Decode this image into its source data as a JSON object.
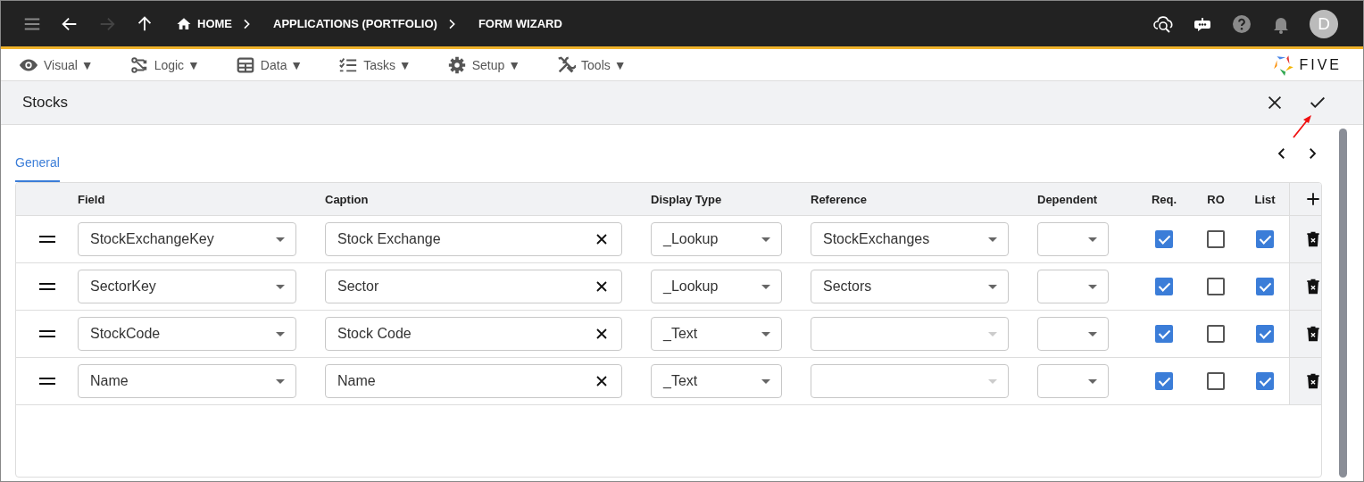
{
  "top_bar": {
    "nav": [
      {
        "kind": "menu",
        "disabled": false
      },
      {
        "kind": "back",
        "disabled": false
      },
      {
        "kind": "forward",
        "disabled": true
      },
      {
        "kind": "up",
        "disabled": false
      }
    ],
    "breadcrumbs": [
      {
        "label": "HOME",
        "kind": "home"
      },
      {
        "label": "APPLICATIONS (PORTFOLIO)"
      },
      {
        "label": "FORM WIZARD"
      }
    ],
    "avatar": "D"
  },
  "menu_bar": [
    {
      "label": "Visual ▼",
      "kind": "eye"
    },
    {
      "label": "Logic ▼",
      "kind": "logic"
    },
    {
      "label": "Data ▼",
      "kind": "table"
    },
    {
      "label": "Tasks ▼",
      "kind": "tasks"
    },
    {
      "label": "Setup ▼",
      "kind": "gear"
    },
    {
      "label": "Tools ▼",
      "kind": "tools"
    }
  ],
  "logo": "FIVE",
  "panel": {
    "title": "Stocks"
  },
  "tabs": [
    {
      "label": "General",
      "selected": true
    }
  ],
  "table": {
    "columns": [
      "Field",
      "Caption",
      "Display Type",
      "Reference",
      "Dependent",
      "Req.",
      "RO",
      "List"
    ],
    "rows": [
      {
        "field": "StockExchangeKey",
        "caption": "Stock Exchange",
        "display_type": "_Lookup",
        "reference": "StockExchanges",
        "reference_disabled": false,
        "req": true,
        "ro": false,
        "list": true
      },
      {
        "field": "SectorKey",
        "caption": "Sector",
        "display_type": "_Lookup",
        "reference": "Sectors",
        "reference_disabled": false,
        "req": true,
        "ro": false,
        "list": true
      },
      {
        "field": "StockCode",
        "caption": "Stock Code",
        "display_type": "_Text",
        "reference_disabled": true,
        "req": true,
        "ro": false,
        "list": true
      },
      {
        "field": "Name",
        "caption": "Name",
        "display_type": "_Text",
        "reference_disabled": true,
        "req": true,
        "ro": false,
        "list": true
      }
    ]
  }
}
